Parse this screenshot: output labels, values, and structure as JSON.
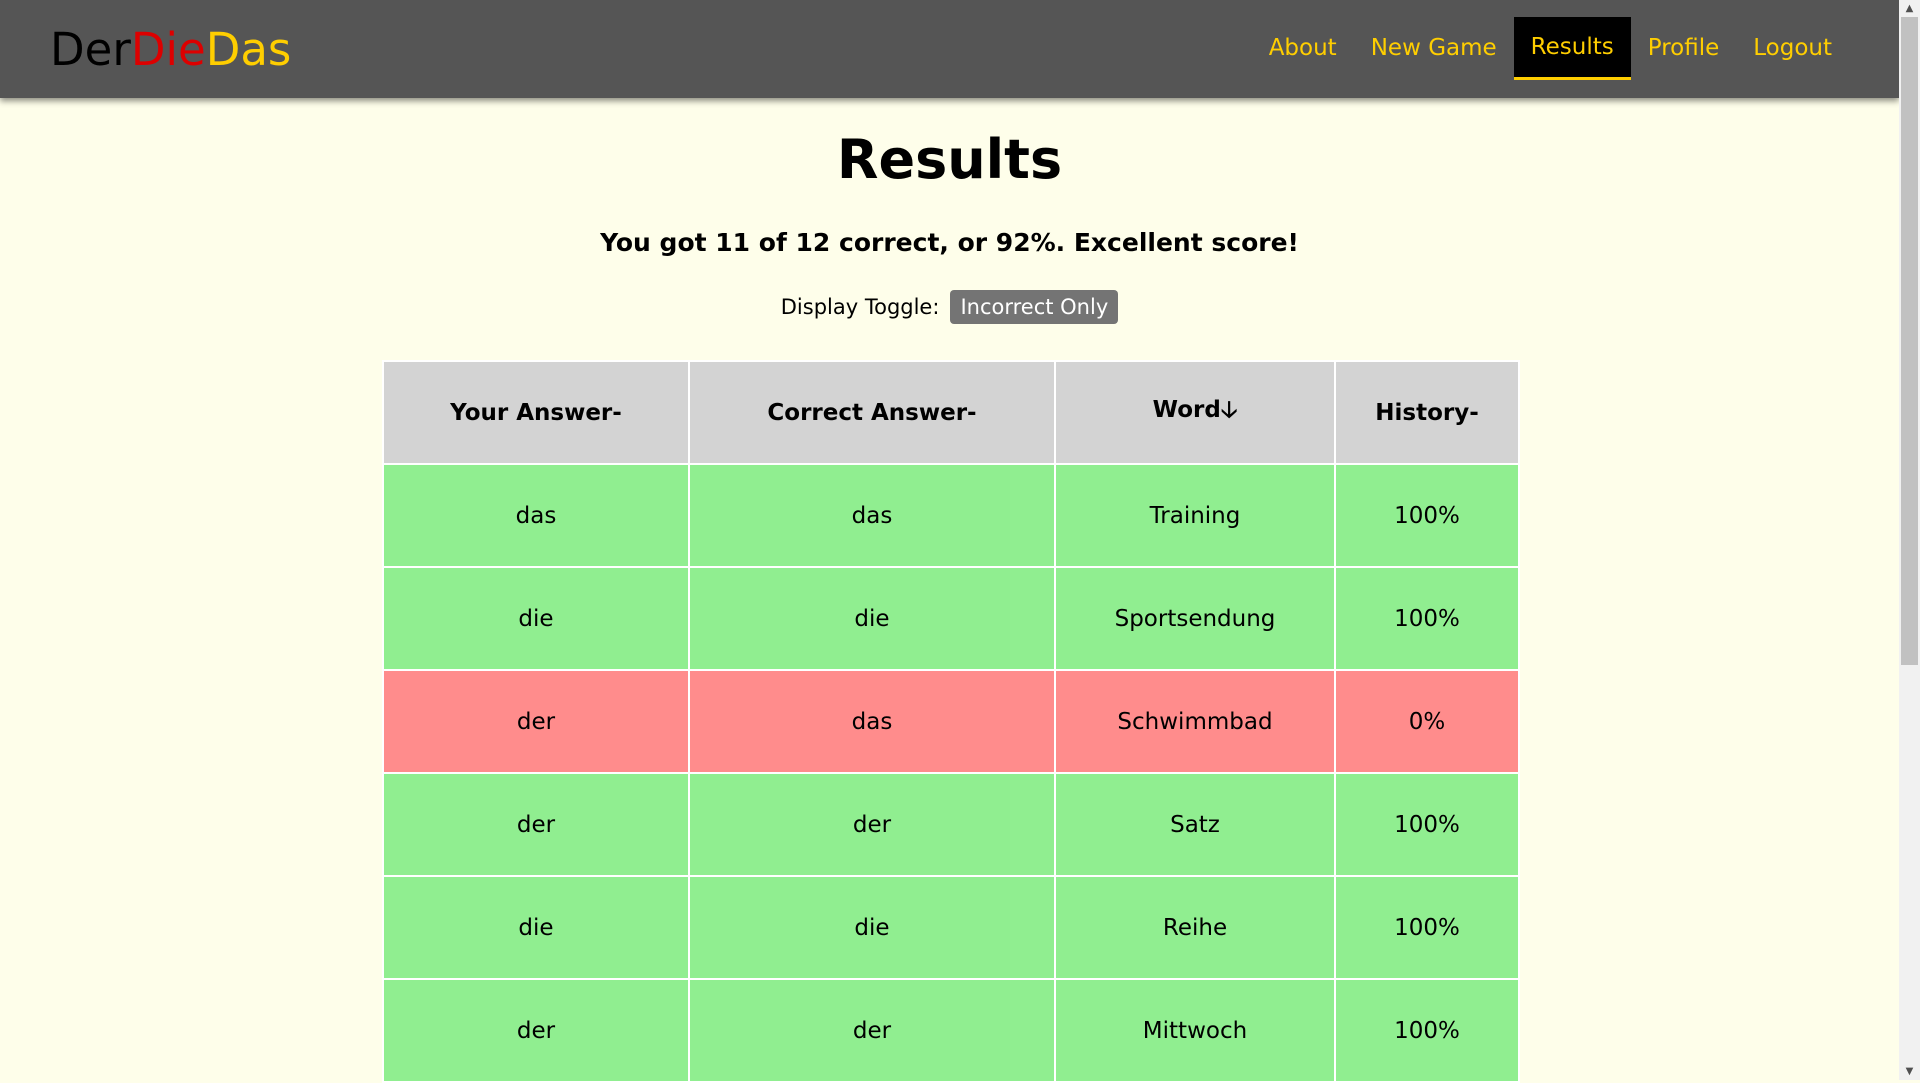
{
  "brand": {
    "part1": "Der",
    "part2": "Die",
    "part3": "Das",
    "colors": {
      "der": "#000000",
      "die": "#dd0000",
      "das": "#ffce00"
    }
  },
  "nav": {
    "about": "About",
    "new_game": "New Game",
    "results": "Results",
    "profile": "Profile",
    "logout": "Logout",
    "active": "Results"
  },
  "page": {
    "title": "Results",
    "summary": "You got 11 of 12 correct, or 92%. Excellent score!",
    "toggle_label": "Display Toggle:",
    "toggle_button": "Incorrect Only"
  },
  "table": {
    "headers": [
      "Your Answer-",
      "Correct Answer-",
      "Word🡣",
      "History-"
    ],
    "rows": [
      {
        "your": "das",
        "correct": "das",
        "word": "Training",
        "history": "100%",
        "status": "correct"
      },
      {
        "your": "die",
        "correct": "die",
        "word": "Sportsendung",
        "history": "100%",
        "status": "correct"
      },
      {
        "your": "der",
        "correct": "das",
        "word": "Schwimmbad",
        "history": "0%",
        "status": "incorrect"
      },
      {
        "your": "der",
        "correct": "der",
        "word": "Satz",
        "history": "100%",
        "status": "correct"
      },
      {
        "your": "die",
        "correct": "die",
        "word": "Reihe",
        "history": "100%",
        "status": "correct"
      },
      {
        "your": "der",
        "correct": "der",
        "word": "Mittwoch",
        "history": "100%",
        "status": "correct"
      }
    ]
  },
  "colors": {
    "navbar": "#555555",
    "nav_link": "#ffce00",
    "background": "#fefeea",
    "correct_row": "#90ee90",
    "incorrect_row": "#ff8c8c",
    "header_cell": "#d3d3d3"
  }
}
